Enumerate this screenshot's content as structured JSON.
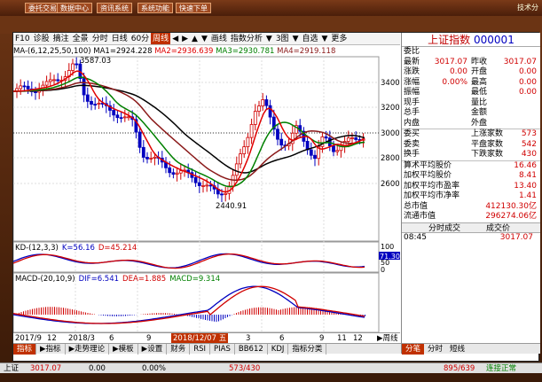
{
  "titlebar": {
    "buttons": [
      "委托交易",
      "数据中心",
      "资讯系统",
      "系统功能",
      "快速下单"
    ],
    "right_text": "技术分"
  },
  "chart_toolbar": {
    "items": [
      "F10",
      "诊股",
      "摘注",
      "全景",
      "分时",
      "日线",
      "60分",
      "周线",
      "◀",
      "▶",
      "▲",
      "▼",
      "画线",
      "指数分析",
      "▼",
      "3图",
      "▼",
      "自选",
      "▼",
      "更多"
    ],
    "active_index": 7
  },
  "ma_legend": {
    "title": "MA-(6,12,25,50,100)",
    "ma1": "MA1=2924.228",
    "ma2": "MA2=2936.639",
    "ma3": "MA3=2930.781",
    "ma4": "MA4=2919.118"
  },
  "main_chart": {
    "y_ticks": [
      "3400",
      "3200",
      "3000",
      "2800",
      "2600"
    ],
    "high_label": "3587.03",
    "low_label": "2440.91"
  },
  "kd_panel": {
    "legend": "KD-(12,3,3)",
    "k": "K=56.16",
    "d": "D=45.214",
    "y_ticks": [
      "100",
      "71.30",
      "50",
      "0"
    ]
  },
  "macd_panel": {
    "legend": "MACD-(20,10,9)",
    "dif": "DIF=6.541",
    "dea": "DEA=1.885",
    "macd": "MACD=9.314"
  },
  "x_axis": {
    "labels": [
      "2017/9",
      "12",
      "2018/3",
      "6",
      "9",
      "12",
      "3",
      "6",
      "9",
      "11",
      "12"
    ],
    "date_tip": "2018/12/07 五",
    "corner": "▶周线"
  },
  "bottom_tabs": {
    "items": [
      "指标",
      "▶指标",
      "▶走势理论",
      "▶模板",
      "▶设置",
      "财务",
      "RSI",
      "PIAS",
      "BB612",
      "KDJ"
    ],
    "right": "指标分类"
  },
  "right_panel": {
    "title": "上证指数",
    "code": "000001",
    "rows": [
      {
        "l1": "委比",
        "v1": "",
        "l2": "",
        "v2": ""
      },
      {
        "l1": "最新",
        "v1": "3017.07",
        "l2": "昨收",
        "v2": "3017.07"
      },
      {
        "l1": "涨跌",
        "v1": "0.00",
        "l2": "开盘",
        "v2": "0.00"
      },
      {
        "l1": "涨幅",
        "v1": "0.00%",
        "l2": "最高",
        "v2": "0.00"
      },
      {
        "l1": "振幅",
        "v1": "",
        "l2": "最低",
        "v2": "0.00"
      },
      {
        "l1": "现手",
        "v1": "",
        "l2": "量比",
        "v2": ""
      },
      {
        "l1": "总手",
        "v1": "",
        "l2": "金额",
        "v2": ""
      },
      {
        "l1": "内盘",
        "v1": "",
        "l2": "外盘",
        "v2": ""
      }
    ],
    "stats": [
      {
        "l1": "委买",
        "v1": "",
        "l2": "上涨家数",
        "v2": "573"
      },
      {
        "l1": "委卖",
        "v1": "",
        "l2": "平盘家数",
        "v2": "542"
      },
      {
        "l1": "换手",
        "v1": "",
        "l2": "下跌家数",
        "v2": "430"
      }
    ],
    "fin": [
      {
        "label": "算术平均股价",
        "value": "16.46"
      },
      {
        "label": "加权平均股价",
        "value": "8.41"
      },
      {
        "label": "加权平均市盈率",
        "value": "13.40"
      },
      {
        "label": "加权平均市净率",
        "value": "1.41"
      },
      {
        "label": "总市值",
        "value": "412130.30亿"
      },
      {
        "label": "流通市值",
        "value": "296274.06亿"
      }
    ],
    "tick_header": {
      "col1": "分时成交",
      "col2": "成交价"
    },
    "tick_row": {
      "time": "08:45",
      "price": "3017.07"
    },
    "bottom_tabs": [
      "分笔",
      "分时",
      "短线"
    ]
  },
  "status_bar": {
    "name": "上证",
    "price": "3017.07",
    "change": "0.00",
    "pct": "0.00%",
    "mid": "573/430",
    "right_counts": "895/639",
    "conn": "连接正常"
  },
  "colors": {
    "accent": "#c03000",
    "up": "#d00000",
    "down": "#0000c0",
    "ma_black": "#000000",
    "ma_red": "#e00000",
    "ma_green": "#008000",
    "ma_brown": "#8b1a1a"
  }
}
